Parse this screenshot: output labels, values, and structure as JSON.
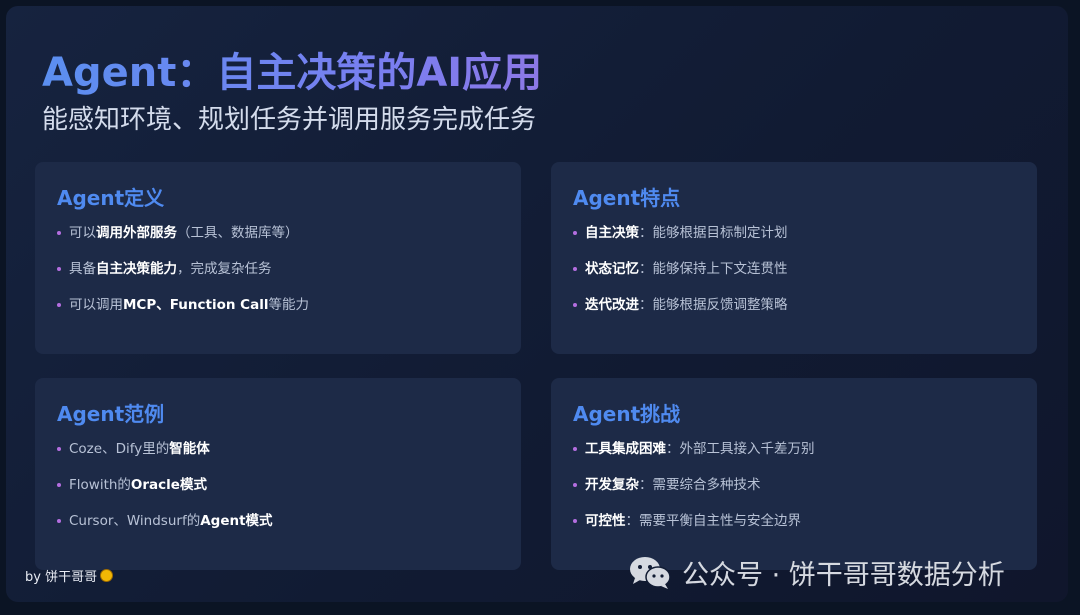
{
  "header": {
    "title": "Agent：自主决策的AI应用",
    "subtitle": "能感知环境、规划任务并调用服务完成任务"
  },
  "cards": [
    {
      "title": "Agent定义",
      "items": [
        {
          "pre": "可以",
          "bold": "调用外部服务",
          "post": "（工具、数据库等）"
        },
        {
          "pre": "具备",
          "bold": "自主决策能力",
          "post": "，完成复杂任务"
        },
        {
          "pre": "可以调用",
          "bold": "MCP、Function Call",
          "post": "等能力"
        }
      ]
    },
    {
      "title": "Agent特点",
      "items": [
        {
          "pre": "",
          "bold": "自主决策",
          "post": "：能够根据目标制定计划"
        },
        {
          "pre": "",
          "bold": "状态记忆",
          "post": "：能够保持上下文连贯性"
        },
        {
          "pre": "",
          "bold": "迭代改进",
          "post": "：能够根据反馈调整策略"
        }
      ]
    },
    {
      "title": "Agent范例",
      "items": [
        {
          "pre": "Coze、Dify里的",
          "bold": "智能体",
          "post": ""
        },
        {
          "pre": "Flowith的",
          "bold": "Oracle模式",
          "post": ""
        },
        {
          "pre": "Cursor、Windsurf的",
          "bold": "Agent模式",
          "post": ""
        }
      ]
    },
    {
      "title": "Agent挑战",
      "items": [
        {
          "pre": "",
          "bold": "工具集成困难",
          "post": "：外部工具接入千差万别"
        },
        {
          "pre": "",
          "bold": "开发复杂",
          "post": "：需要综合多种技术"
        },
        {
          "pre": "",
          "bold": "可控性",
          "post": "：需要平衡自主性与安全边界"
        }
      ]
    }
  ],
  "footer": {
    "author": "by 饼干哥哥",
    "author_icon": "smiley-emoji-icon",
    "watermark": "公众号 · 饼干哥哥数据分析",
    "watermark_icon": "wechat-icon"
  },
  "colors": {
    "accent": "#4f8af0",
    "bullet": "#b46ee0",
    "card_bg": "#1d2a47",
    "page_bg": "#0b1424"
  }
}
